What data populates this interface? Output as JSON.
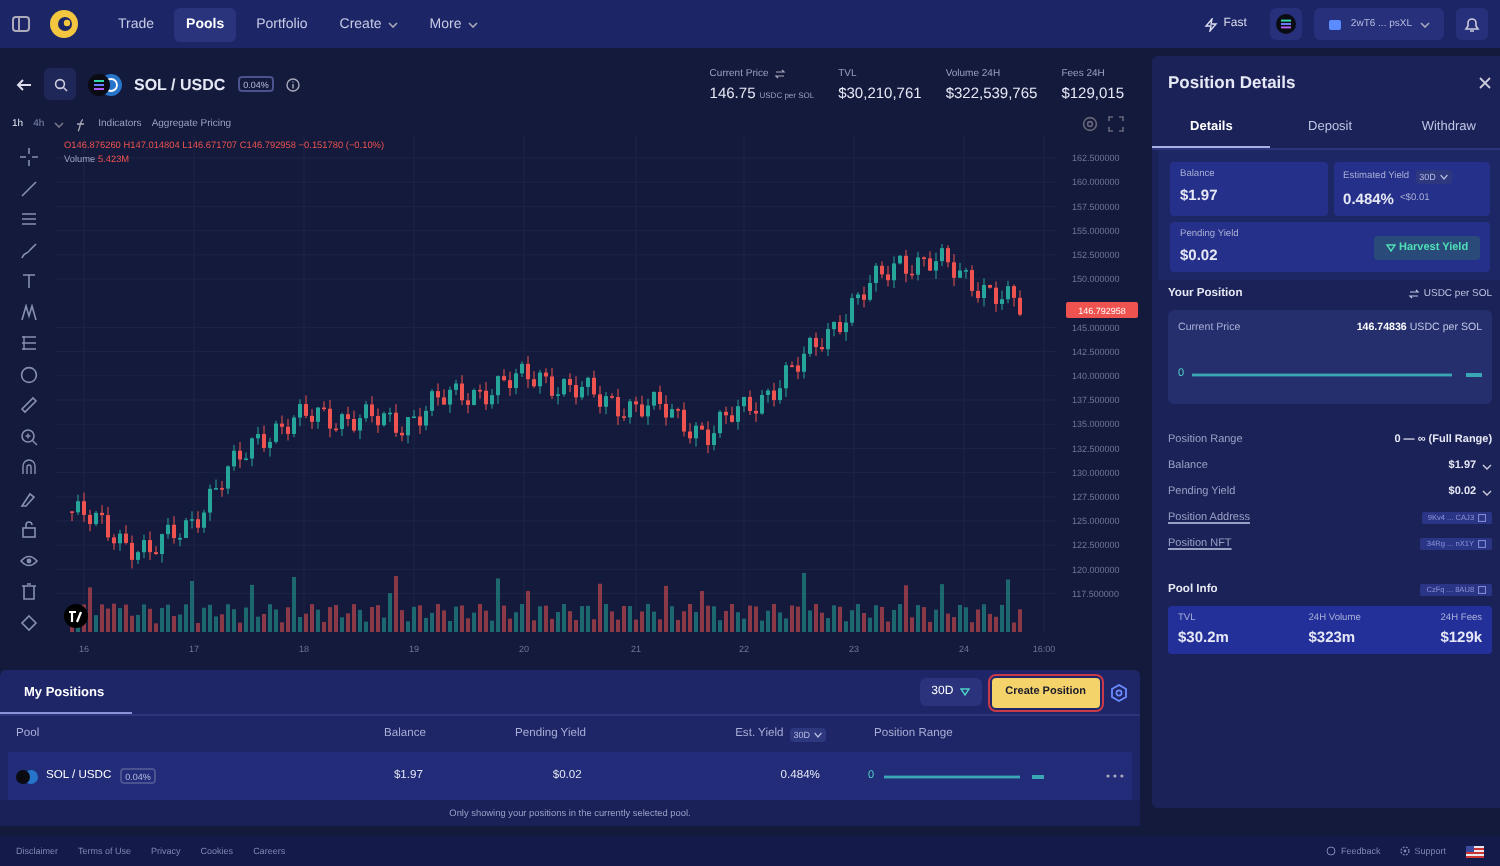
{
  "nav": {
    "items": [
      {
        "label": "Trade",
        "selected": false,
        "dropdown": false
      },
      {
        "label": "Pools",
        "selected": true,
        "dropdown": false
      },
      {
        "label": "Portfolio",
        "selected": false,
        "dropdown": false
      },
      {
        "label": "Create",
        "selected": false,
        "dropdown": true
      },
      {
        "label": "More",
        "selected": false,
        "dropdown": true
      }
    ],
    "speed": "Fast",
    "wallet": "2wT6 ... psXL"
  },
  "pair": {
    "name": "SOL / USDC",
    "fee": "0.04%"
  },
  "stats": [
    {
      "label": "Current Price",
      "value": "146.75",
      "unit": "USDC per SOL",
      "swap": true
    },
    {
      "label": "TVL",
      "value": "$30,210,761",
      "swap": false
    },
    {
      "label": "Volume 24H",
      "value": "$322,539,765",
      "swap": false
    },
    {
      "label": "Fees 24H",
      "value": "$129,015",
      "swap": false
    }
  ],
  "chart": {
    "intervals": [
      {
        "label": "1h",
        "selected": true
      },
      {
        "label": "4h",
        "selected": false
      }
    ],
    "indicators": "Indicators",
    "aggregate": "Aggregate Pricing",
    "ohlc": "O146.876260 H147.014804 L146.671707 C146.792958 −0.151780 (−0.10%)",
    "volume_label": "Volume",
    "volume_value": "5.423M",
    "price_axis": [
      "162.500000",
      "160.000000",
      "157.500000",
      "155.000000",
      "152.500000",
      "150.000000",
      "145.000000",
      "142.500000",
      "140.000000",
      "137.500000",
      "135.000000",
      "132.500000",
      "130.000000",
      "127.500000",
      "125.000000",
      "122.500000",
      "120.000000",
      "117.500000"
    ],
    "last_price": "146.792958",
    "time_axis": [
      "16",
      "17",
      "18",
      "19",
      "20",
      "21",
      "22",
      "23",
      "24",
      "16:00"
    ]
  },
  "positions": {
    "tab": "My Positions",
    "tab_selected": true,
    "period": "30D",
    "create_button": "Create Position",
    "columns": [
      "Pool",
      "Balance",
      "Pending Yield",
      "Est. Yield",
      "Position Range"
    ],
    "yield_period": "30D",
    "rows": [
      {
        "pool": "SOL / USDC",
        "fee": "0.04%",
        "balance": "$1.97",
        "pending_yield": "$0.02",
        "est_yield": "0.484%",
        "range_start": "0"
      }
    ],
    "note": "Only showing your positions in the currently selected pool."
  },
  "details": {
    "title": "Position Details",
    "tabs": [
      {
        "label": "Details",
        "selected": true
      },
      {
        "label": "Deposit",
        "selected": false
      },
      {
        "label": "Withdraw",
        "selected": false
      }
    ],
    "balance_label": "Balance",
    "balance": "$1.97",
    "yield_label": "Estimated Yield",
    "yield_period": "30D",
    "yield": "0.484%",
    "yield_sub": "<$0.01",
    "pending_label": "Pending Yield",
    "pending": "$0.02",
    "harvest_button": "Harvest Yield",
    "your_position": "Your Position",
    "unit_toggle": "USDC per SOL",
    "current_price_label": "Current Price",
    "current_price": "146.74836",
    "current_price_unit": "USDC per SOL",
    "range_start": "0",
    "rows": [
      {
        "label": "Position Range",
        "value": "0 — ∞ (Full Range)",
        "kind": "text"
      },
      {
        "label": "Balance",
        "value": "$1.97",
        "kind": "dropdown"
      },
      {
        "label": "Pending Yield",
        "value": "$0.02",
        "kind": "dropdown"
      },
      {
        "label": "Position Address",
        "value": "9Kv4 ... CAJ3",
        "kind": "address"
      },
      {
        "label": "Position NFT",
        "value": "34Rg ... nX1Y",
        "kind": "address"
      }
    ],
    "pool_info": "Pool Info",
    "pool_address": "CzFq ... 8AU8",
    "pool_stats": [
      {
        "label": "TVL",
        "value": "$30.2m"
      },
      {
        "label": "24H Volume",
        "value": "$323m"
      },
      {
        "label": "24H Fees",
        "value": "$129k"
      }
    ]
  },
  "footer": {
    "links": [
      "Disclaimer",
      "Terms of Use",
      "Privacy",
      "Cookies",
      "Careers"
    ],
    "feedback": "Feedback",
    "support": "Support"
  }
}
